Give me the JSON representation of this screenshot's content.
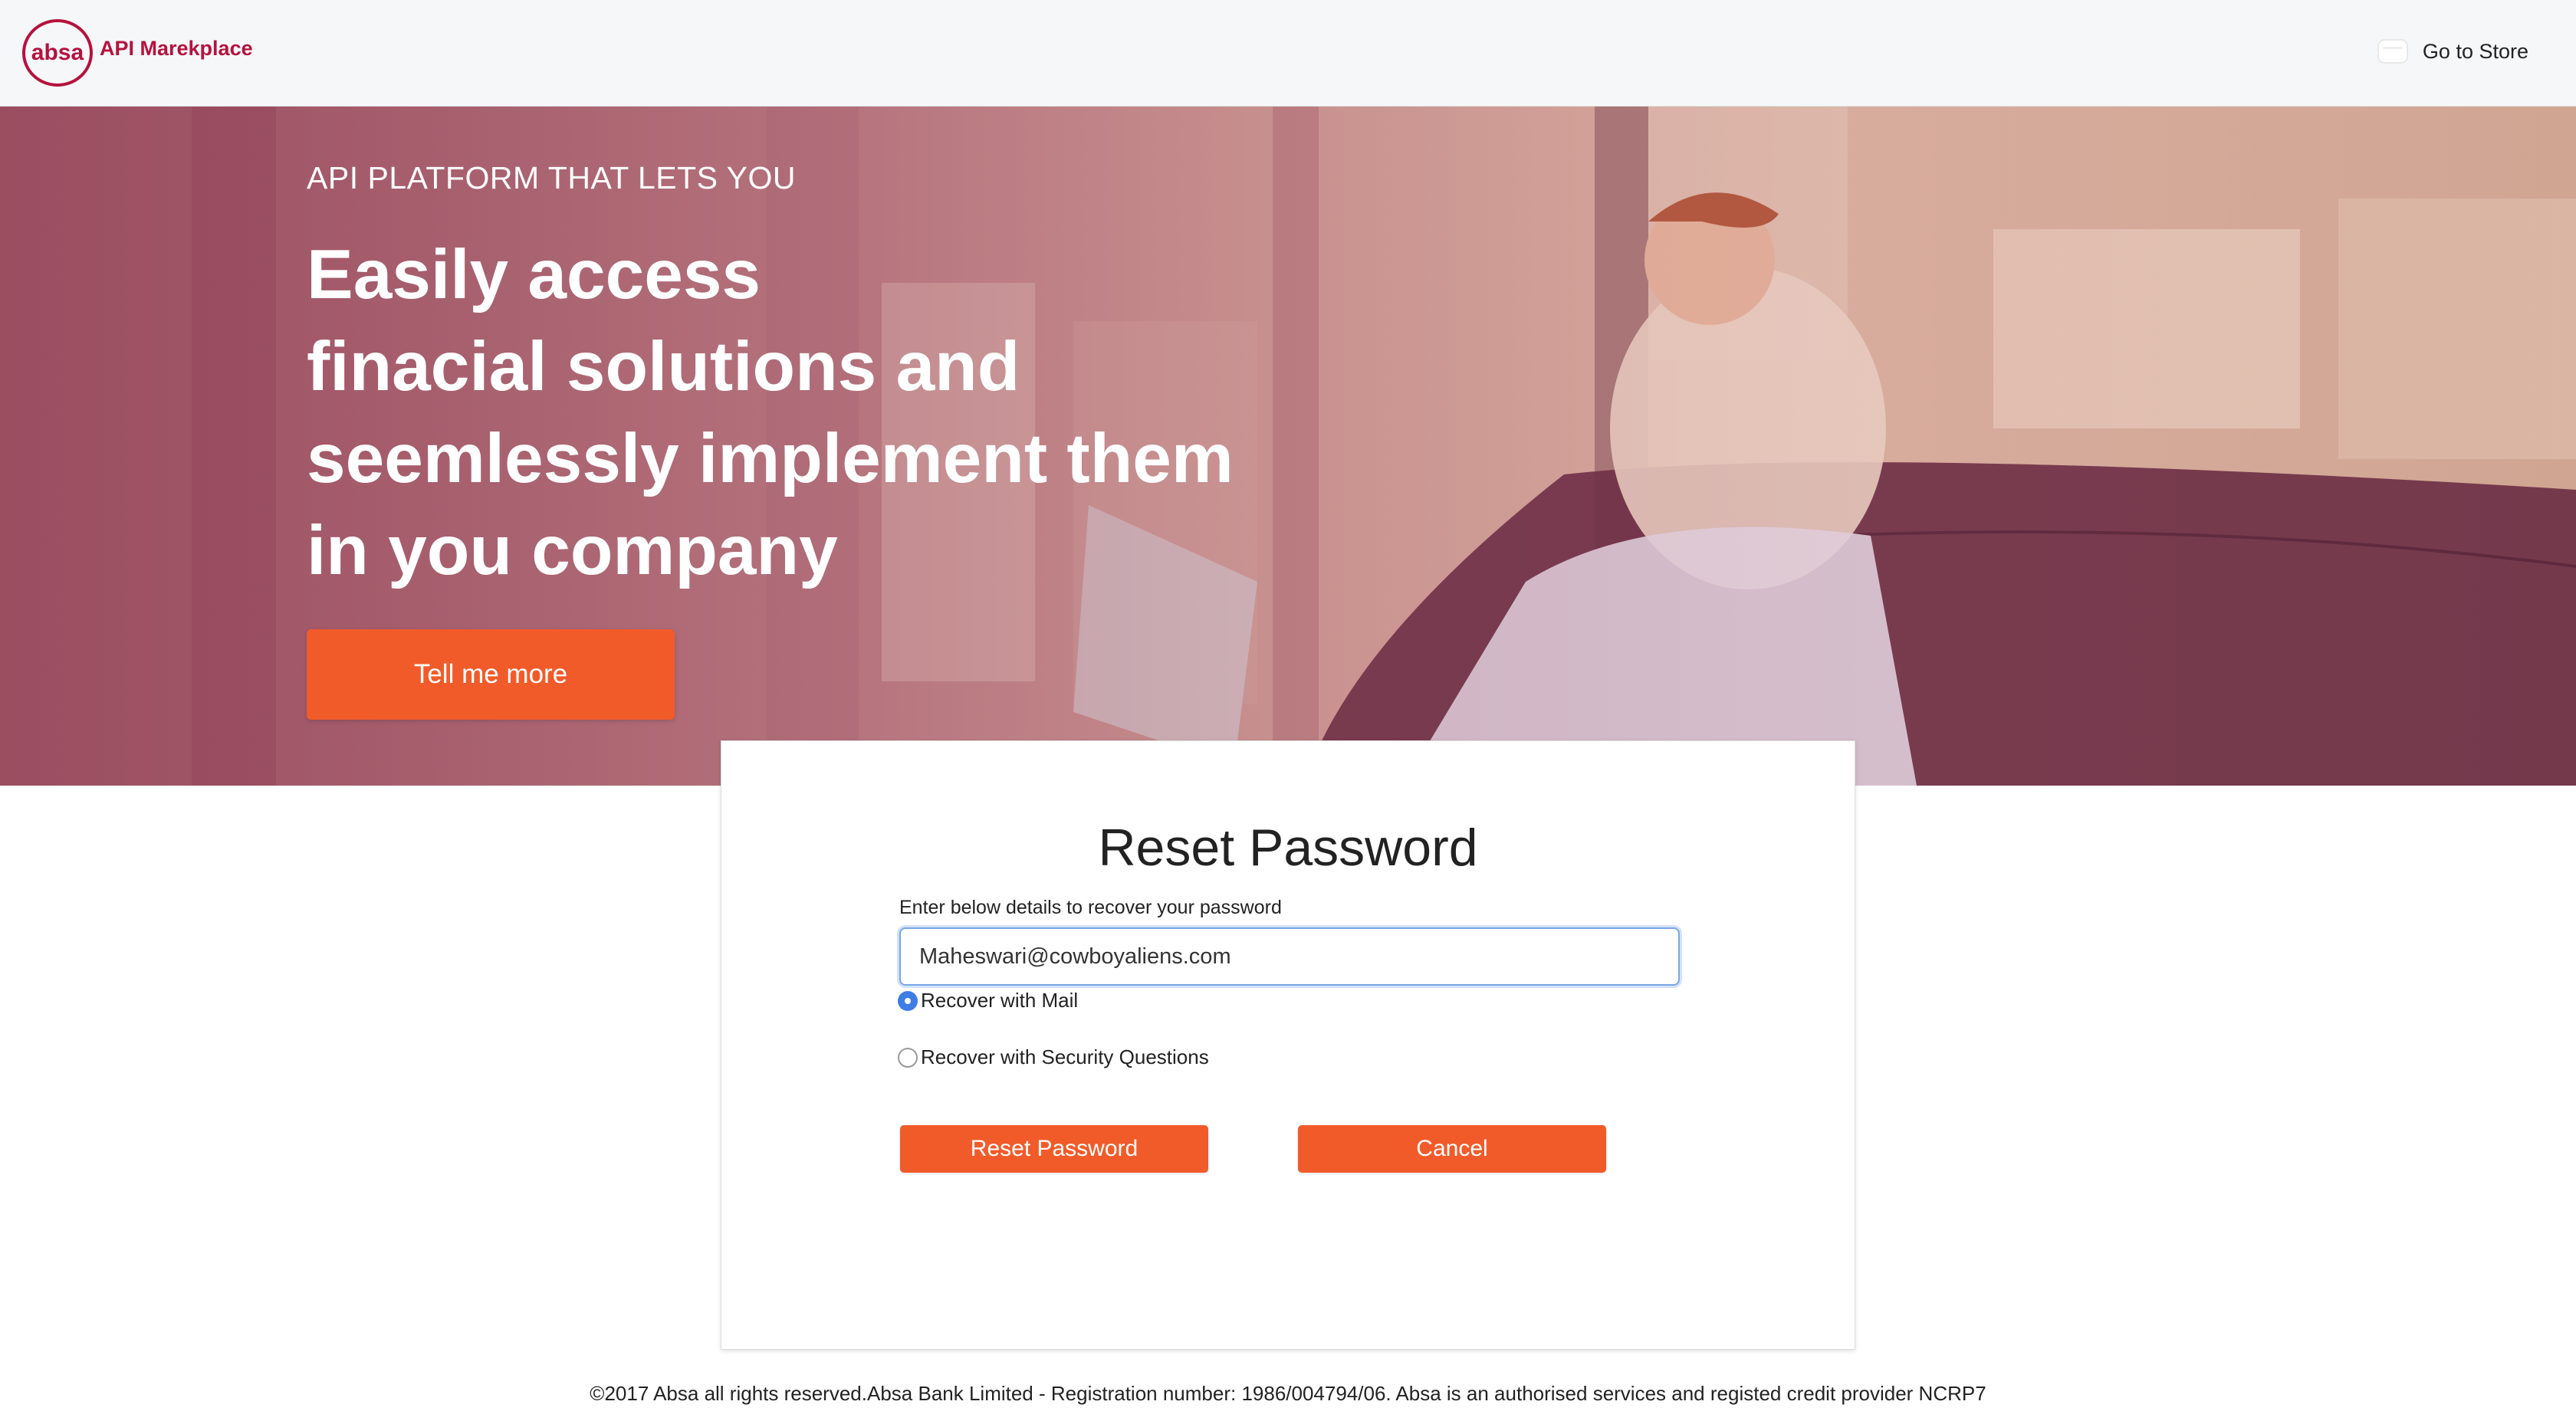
{
  "header": {
    "brand_logo_text": "absa",
    "brand_name": "API Marekplace",
    "store_link": "Go to Store"
  },
  "hero": {
    "kicker": "API PLATFORM THAT LETS YOU",
    "headline_lines": [
      "Easily access",
      "finacial solutions and",
      "seemlessly implement them",
      "in you company"
    ],
    "cta_label": "Tell me more"
  },
  "reset_form": {
    "title": "Reset Password",
    "subtitle": "Enter below details to recover your password",
    "email_value": "Maheswari@cowboyaliens.com",
    "options": [
      {
        "label": "Recover with Mail",
        "selected": true
      },
      {
        "label": "Recover with Security Questions",
        "selected": false
      }
    ],
    "reset_button": "Reset Password",
    "cancel_button": "Cancel"
  },
  "footer": {
    "text": "©2017 Absa all rights reserved.Absa Bank Limited - Registration number: 1986/004794/06. Absa is an authorised services and registed credit provider NCRP7"
  },
  "colors": {
    "brand_red": "#b5123e",
    "accent_orange": "#f15b2a",
    "radio_blue": "#3d7de4"
  }
}
